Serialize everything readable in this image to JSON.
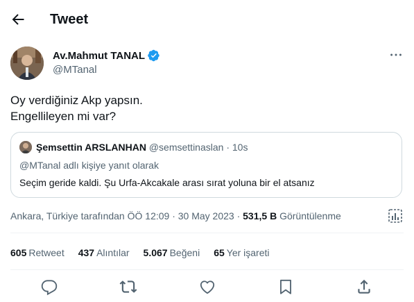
{
  "header": {
    "title": "Tweet",
    "back_icon": "arrow-left-icon"
  },
  "author": {
    "name": "Av.Mahmut TANAL",
    "handle": "@MTanal",
    "verified_color": "#1d9bf0"
  },
  "tweet": {
    "text": "Oy verdiğiniz Akp yapsın.\nEngellileyen mi var?"
  },
  "quote": {
    "name": "Şemsettin ARSLANHAN",
    "handle_time": "@semsettinaslan · 10s",
    "reply_to": "@MTanal adlı kişiye yanıt olarak",
    "text": "Seçim geride kaldi. Şu Urfa-Akcakale arası sırat yoluna bir el atsanız"
  },
  "meta": {
    "location_time": "Ankara, Türkiye tarafından ÖÖ 12:09 · 30 May 2023 · ",
    "views_count": "531,5 B",
    "views_label": "Görüntülenme"
  },
  "stats": [
    {
      "count": "605",
      "label": "Retweet"
    },
    {
      "count": "437",
      "label": "Alıntılar"
    },
    {
      "count": "5.067",
      "label": "Beğeni"
    },
    {
      "count": "65",
      "label": "Yer işareti"
    }
  ],
  "actions": [
    "reply-icon",
    "retweet-icon",
    "like-icon",
    "bookmark-icon",
    "share-icon"
  ],
  "colors": {
    "text": "#0f1419",
    "secondary": "#536471",
    "border": "#cfd9de",
    "accent": "#1d9bf0"
  }
}
